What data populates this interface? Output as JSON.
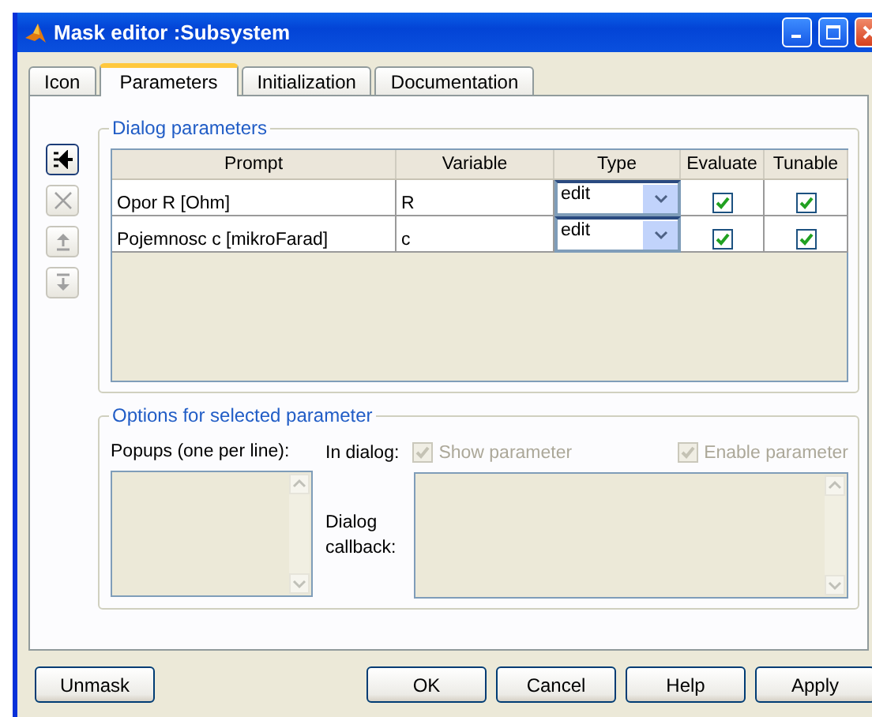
{
  "window": {
    "title": "Mask editor :Subsystem"
  },
  "tabs": [
    {
      "label": "Icon",
      "selected": false
    },
    {
      "label": "Parameters",
      "selected": true
    },
    {
      "label": "Initialization",
      "selected": false
    },
    {
      "label": "Documentation",
      "selected": false
    }
  ],
  "side_buttons": [
    {
      "kind": "add",
      "disabled": false
    },
    {
      "kind": "delete",
      "disabled": true
    },
    {
      "kind": "up",
      "disabled": true
    },
    {
      "kind": "down",
      "disabled": true
    }
  ],
  "dialog_parameters": {
    "title": "Dialog parameters",
    "columns": [
      "Prompt",
      "Variable",
      "Type",
      "Evaluate",
      "Tunable"
    ],
    "rows": [
      {
        "prompt": "Opor R [Ohm]",
        "variable": "R",
        "type": "edit",
        "evaluate": true,
        "tunable": true
      },
      {
        "prompt": "Pojemnosc c [mikroFarad]",
        "variable": "c",
        "type": "edit",
        "evaluate": true,
        "tunable": true
      }
    ]
  },
  "options": {
    "title": "Options for selected parameter",
    "popups_label": "Popups (one per line):",
    "in_dialog_label": "In dialog:",
    "checks": [
      {
        "label": "Show parameter",
        "checked": true,
        "disabled": true
      },
      {
        "label": "Enable parameter",
        "checked": true,
        "disabled": true
      }
    ],
    "callback_label": "Dialog callback:"
  },
  "buttons": [
    "Unmask",
    "OK",
    "Cancel",
    "Help",
    "Apply"
  ]
}
